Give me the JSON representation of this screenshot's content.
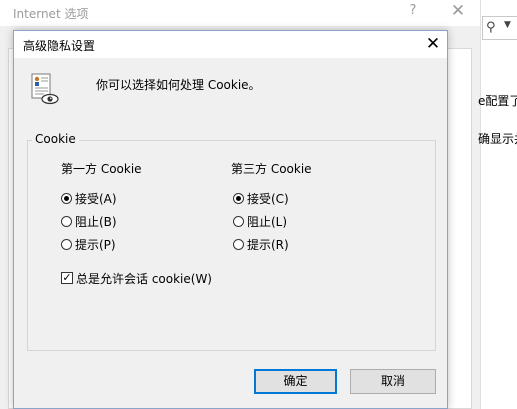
{
  "background_window": {
    "title": "Internet 选项",
    "help_glyph": "?",
    "close_glyph": "✕",
    "right_text_1": "e配置了",
    "right_text_2": "确显示并",
    "search_icon": "search-icon"
  },
  "dialog": {
    "title": "高级隐私设置",
    "close_glyph": "✕",
    "info_text": "你可以选择如何处理 Cookie。",
    "group_label": "Cookie",
    "first_party": {
      "heading": "第一方 Cookie",
      "options": [
        {
          "label": "接受(A)",
          "checked": true
        },
        {
          "label": "阻止(B)",
          "checked": false
        },
        {
          "label": "提示(P)",
          "checked": false
        }
      ]
    },
    "third_party": {
      "heading": "第三方 Cookie",
      "options": [
        {
          "label": "接受(C)",
          "checked": true
        },
        {
          "label": "阻止(L)",
          "checked": false
        },
        {
          "label": "提示(R)",
          "checked": false
        }
      ]
    },
    "session_checkbox": {
      "label": "总是允许会话 cookie(W)",
      "checked": true,
      "check_glyph": "✓"
    },
    "ok_label": "确定",
    "cancel_label": "取消"
  },
  "colors": {
    "accent": "#0078d7",
    "dialog_bg": "#f0f0f0"
  }
}
